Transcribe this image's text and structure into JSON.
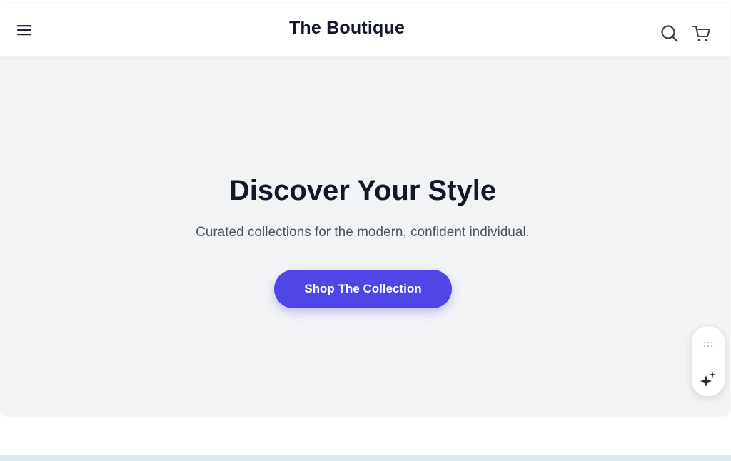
{
  "header": {
    "brand": "The Boutique",
    "icons": {
      "menu": "hamburger-menu-icon",
      "search": "search-icon",
      "cart": "shopping-cart-icon"
    }
  },
  "hero": {
    "title": "Discover Your Style",
    "subtitle": "Curated collections for the modern, confident individual.",
    "cta_label": "Shop The Collection"
  },
  "floating_widget": {
    "icons": {
      "handle": "drag-grip-icon",
      "assistant": "sparkle-icon"
    }
  },
  "colors": {
    "accent": "#4f46e5",
    "hero_background": "#f3f4f6",
    "heading_text": "#111827",
    "body_text": "#4b5563"
  }
}
